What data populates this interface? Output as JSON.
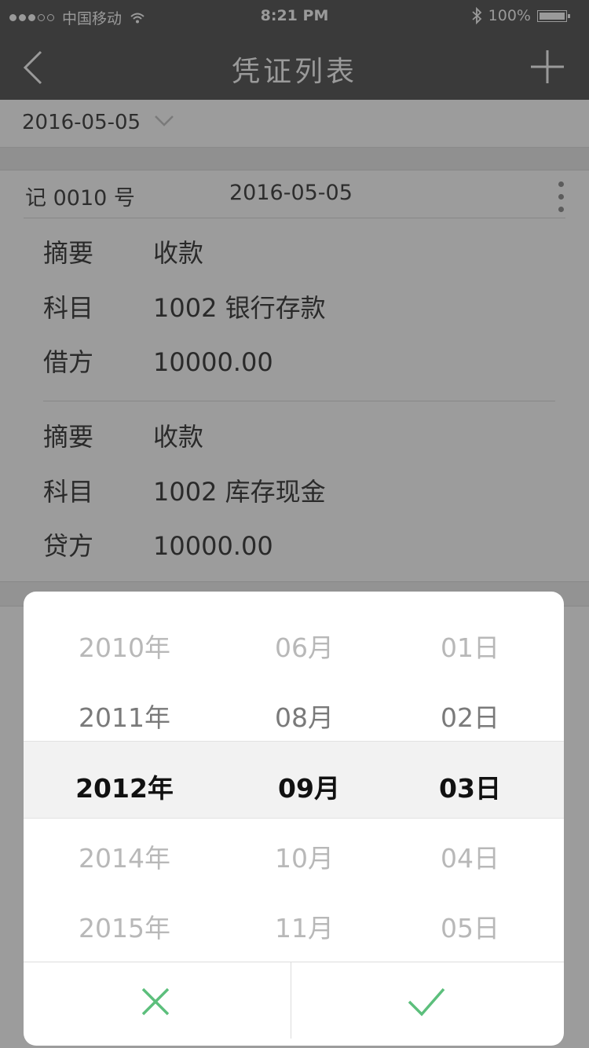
{
  "status_bar": {
    "carrier": "中国移动",
    "time": "8:21 PM",
    "battery": "100%"
  },
  "nav": {
    "title": "凭证列表"
  },
  "filter": {
    "date": "2016-05-05"
  },
  "voucher": {
    "number": "记 0010 号",
    "date": "2016-05-05",
    "entries": [
      {
        "summary_label": "摘要",
        "summary": "收款",
        "account_label": "科目",
        "account": "1002 银行存款",
        "amount_label": "借方",
        "amount": "10000.00"
      },
      {
        "summary_label": "摘要",
        "summary": "收款",
        "account_label": "科目",
        "account": "1002 库存现金",
        "amount_label": "贷方",
        "amount": "10000.00"
      }
    ]
  },
  "date_picker": {
    "years": [
      "2010年",
      "2011年",
      "2012年",
      "2014年",
      "2015年"
    ],
    "months": [
      "06月",
      "08月",
      "09月",
      "10月",
      "11月"
    ],
    "days": [
      "01日",
      "02日",
      "03日",
      "04日",
      "05日"
    ],
    "selected_index": 2,
    "accent_color": "#5cbf7c"
  }
}
